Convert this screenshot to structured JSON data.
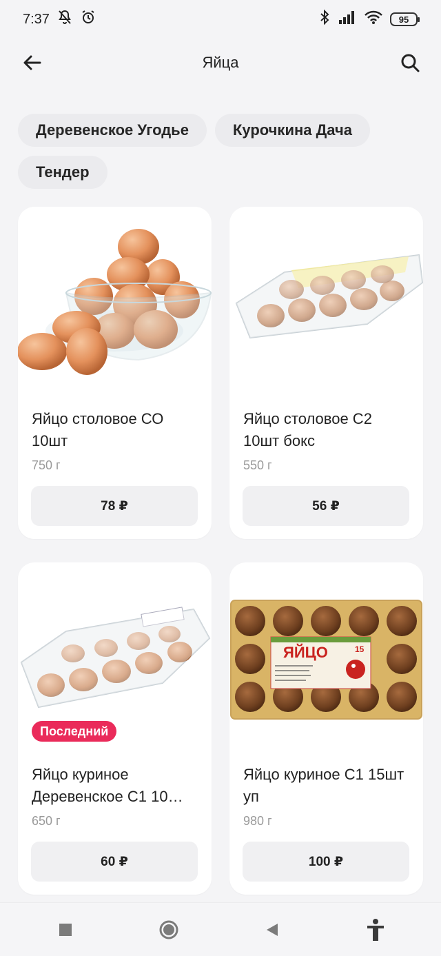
{
  "status_bar": {
    "time": "7:37",
    "battery": "95",
    "icons": [
      "mute-bell-icon",
      "alarm-icon",
      "bluetooth-icon",
      "signal-icon",
      "wifi-icon",
      "battery-icon"
    ]
  },
  "header": {
    "title": "Яйца",
    "back_icon": "back-arrow-icon",
    "search_icon": "search-icon"
  },
  "chips": [
    {
      "label": "Деревенское Угодье"
    },
    {
      "label": "Курочкина Дача"
    },
    {
      "label": "Тендер"
    }
  ],
  "products": [
    {
      "name": "Яйцо столовое СО 10шт",
      "weight": "750 г",
      "price": "78 ₽",
      "badge": "",
      "image": "eggs-in-glass-bowl"
    },
    {
      "name": "Яйцо столовое С2 10шт бокс",
      "weight": "550 г",
      "price": "56 ₽",
      "badge": "",
      "image": "eggs-plastic-box"
    },
    {
      "name": "Яйцо куриное Деревенское С1 10…",
      "weight": "650 г",
      "price": "60 ₽",
      "badge": "Последний",
      "image": "eggs-plastic-box"
    },
    {
      "name": "Яйцо куриное С1 15шт уп",
      "weight": "980 г",
      "price": "100 ₽",
      "badge": "",
      "image": "eggs-tray-15"
    }
  ],
  "tray_label": {
    "title": "ЯЙЦО",
    "count": "15"
  },
  "colors": {
    "badge": "#ea2b5a",
    "chip_bg": "#ebebee",
    "card_bg": "#ffffff",
    "page_bg": "#f4f4f6"
  },
  "nav_bar": {
    "buttons": [
      "recents-square-icon",
      "home-circle-icon",
      "back-triangle-icon",
      "accessibility-icon"
    ]
  }
}
